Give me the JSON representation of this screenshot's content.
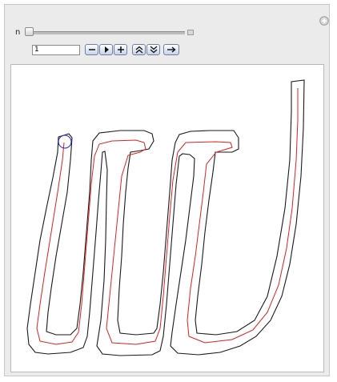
{
  "controls": {
    "n_label": "n",
    "n_value": "1",
    "buttons": [
      {
        "name": "decrement-button",
        "icon": "minus-icon"
      },
      {
        "name": "play-button",
        "icon": "play-icon"
      },
      {
        "name": "increment-button",
        "icon": "plus-icon"
      },
      {
        "name": "faster-button",
        "icon": "double-up-icon"
      },
      {
        "name": "slower-button",
        "icon": "double-down-icon"
      },
      {
        "name": "direction-button",
        "icon": "right-arrow-icon"
      }
    ],
    "slider_value_fraction": 0.0
  },
  "plot": {
    "outline_color": "#1a1a1a",
    "path_color": "#e02020",
    "marker_color": "#2a2acc"
  }
}
